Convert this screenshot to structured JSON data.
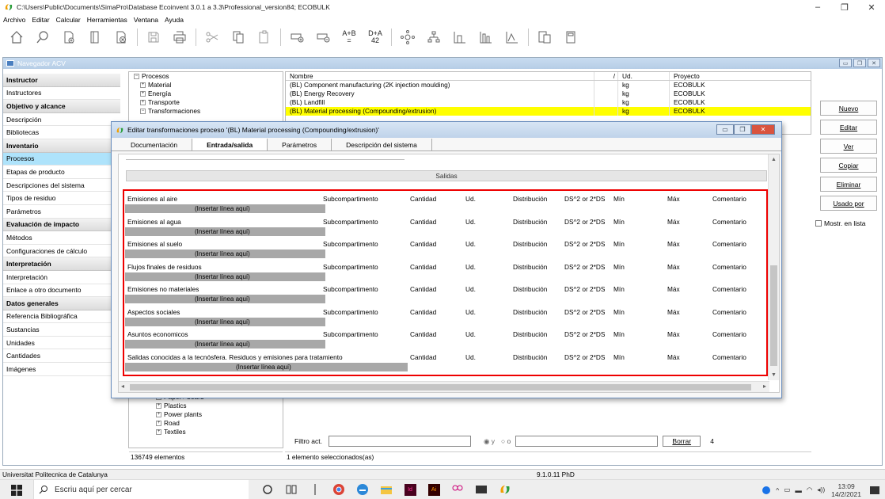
{
  "window": {
    "title": "C:\\Users\\Public\\Documents\\SimaPro\\Database Ecoinvent 3.0.1 a 3.3\\Professional_version84; ECOBULK",
    "controls": [
      "–",
      "❐",
      "✕"
    ]
  },
  "menu": [
    "Archivo",
    "Editar",
    "Calcular",
    "Herramientas",
    "Ventana",
    "Ayuda"
  ],
  "toolbar": {
    "formula1_top": "A+B",
    "formula1_bottom": "=",
    "formula2_top": "D+A",
    "formula2_bottom": "42"
  },
  "navigator": {
    "title": "Navegador ACV",
    "items": [
      {
        "label": "Instructor",
        "type": "header"
      },
      {
        "label": "Instructores",
        "type": "item"
      },
      {
        "label": "Objetivo y alcance",
        "type": "header"
      },
      {
        "label": "Descripción",
        "type": "item"
      },
      {
        "label": "Bibliotecas",
        "type": "item"
      },
      {
        "label": "Inventario",
        "type": "header"
      },
      {
        "label": "Procesos",
        "type": "selected"
      },
      {
        "label": "Etapas de producto",
        "type": "item"
      },
      {
        "label": "Descripciones del sistema",
        "type": "item"
      },
      {
        "label": "Tipos de residuo",
        "type": "item"
      },
      {
        "label": "Parámetros",
        "type": "item"
      },
      {
        "label": "Evaluación de impacto",
        "type": "header"
      },
      {
        "label": "Métodos",
        "type": "item"
      },
      {
        "label": "Configuraciones de cálculo",
        "type": "item"
      },
      {
        "label": "Interpretación",
        "type": "header"
      },
      {
        "label": "Interpretación",
        "type": "item"
      },
      {
        "label": "Enlace a otro documento",
        "type": "item"
      },
      {
        "label": "Datos generales",
        "type": "header"
      },
      {
        "label": "Referencia Bibliográfica",
        "type": "item"
      },
      {
        "label": "Sustancias",
        "type": "item"
      },
      {
        "label": "Unidades",
        "type": "item"
      },
      {
        "label": "Cantidades",
        "type": "item"
      },
      {
        "label": "Imágenes",
        "type": "item"
      }
    ]
  },
  "tree": {
    "top": [
      "Procesos",
      "Material",
      "Energía",
      "Transporte",
      "Transformaciones"
    ],
    "bottom": [
      "Paper+ board",
      "Plastics",
      "Power plants",
      "Road",
      "Textiles"
    ]
  },
  "process_table": {
    "headers": [
      "Nombre",
      "/",
      "Ud.",
      "Proyecto"
    ],
    "rows": [
      {
        "name": "(BL) Component manufacturing (2K injection moulding)",
        "unit": "kg",
        "project": "ECOBULK"
      },
      {
        "name": "(BL) Energy Recovery",
        "unit": "kg",
        "project": "ECOBULK"
      },
      {
        "name": "(BL) Landfill",
        "unit": "kg",
        "project": "ECOBULK"
      },
      {
        "name": "(BL) Material processing (Compounding/extrusion)",
        "unit": "kg",
        "project": "ECOBULK"
      }
    ]
  },
  "right_buttons": [
    "Nuevo",
    "Editar",
    "Ver",
    "Copiar",
    "Eliminar",
    "Usado por"
  ],
  "mostrar_lista": "Mostr. en lista",
  "filter": {
    "label": "Filtro act.",
    "radio_y": "y",
    "radio_o": "o",
    "borrar": "Borrar",
    "count": "4"
  },
  "status": {
    "elements": "136749 elementos",
    "selected": "1 elemento seleccionados(as)"
  },
  "statusbar": {
    "left": "Universitat Politecnica de Catalunya",
    "version": "9.1.0.11 PhD"
  },
  "dialog": {
    "title": "Editar transformaciones proceso '(BL) Material processing (Compounding/extrusion)'",
    "tabs": [
      "Documentación",
      "Entrada/salida",
      "Parámetros",
      "Descripción del sistema"
    ],
    "active_tab": 1,
    "salidas": "Salidas",
    "columns": [
      "Subcompartimento",
      "Cantidad",
      "Ud.",
      "Distribución",
      "DS^2 or 2*DS",
      "Mín",
      "Máx",
      "Comentario"
    ],
    "insert_label": "(Insertar línea aquí)",
    "groups": [
      {
        "label": "Emisiones al aire",
        "has_sub": true
      },
      {
        "label": "Emisiones al agua",
        "has_sub": true
      },
      {
        "label": "Emisiones al suelo",
        "has_sub": true
      },
      {
        "label": "Flujos finales de residuos",
        "has_sub": true
      },
      {
        "label": "Emisiones no materiales",
        "has_sub": true
      },
      {
        "label": "Aspectos sociales",
        "has_sub": true
      },
      {
        "label": "Asuntos economicos",
        "has_sub": true
      },
      {
        "label": "Salidas conocidas a la tecnósfera. Residuos y emisiones para tratamiento",
        "has_sub": false
      }
    ]
  },
  "taskbar": {
    "search_placeholder": "Escriu aquí per cercar",
    "time": "13:09",
    "date": "14/2/2021"
  },
  "colors": {
    "highlight": "#ffff00",
    "selected": "#aee3fb",
    "red_outline": "#e00000"
  }
}
